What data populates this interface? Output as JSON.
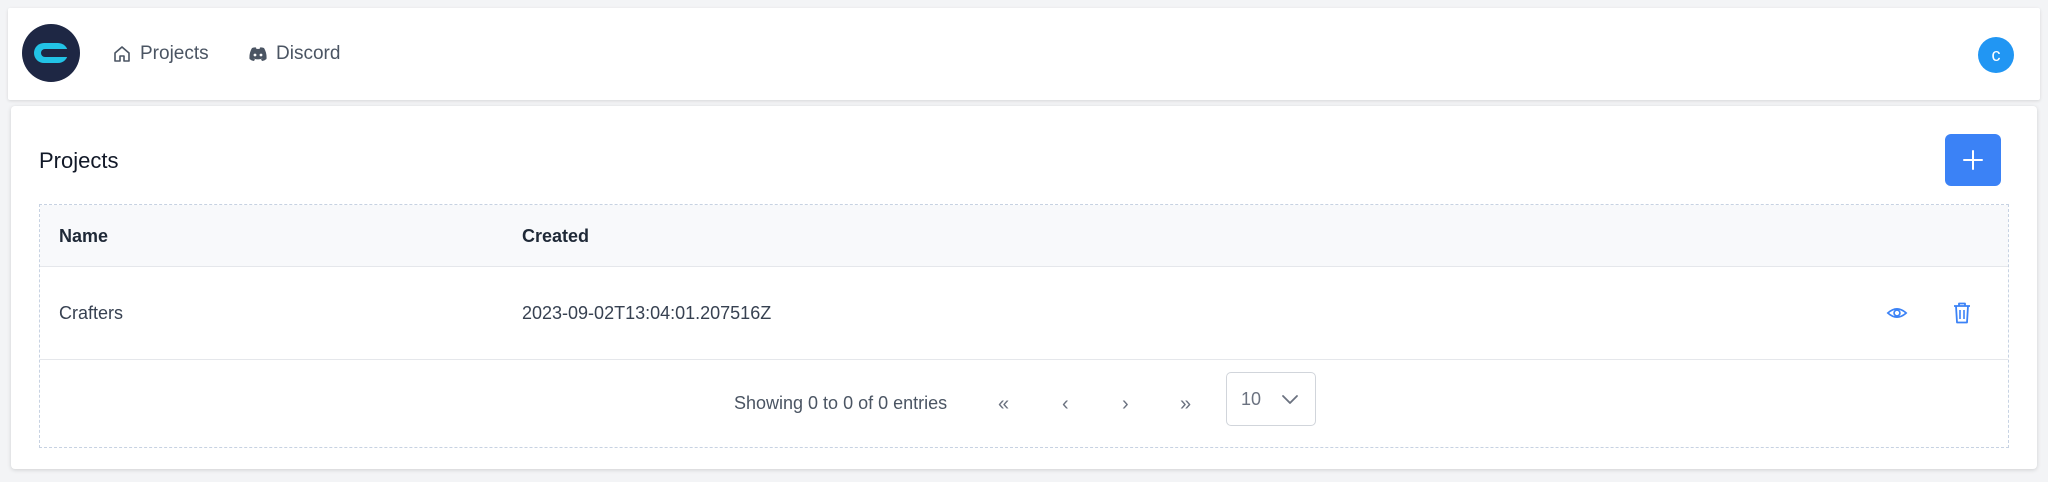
{
  "nav": {
    "projects_label": "Projects",
    "discord_label": "Discord",
    "avatar_initial": "c"
  },
  "page": {
    "title": "Projects",
    "add_icon": "plus-icon"
  },
  "table": {
    "columns": [
      "Name",
      "Created"
    ],
    "rows": [
      {
        "name": "Crafters",
        "created": "2023-09-02T13:04:01.207516Z"
      }
    ]
  },
  "pagination": {
    "info": "Showing 0 to 0 of 0 entries",
    "first": "«",
    "prev": "‹",
    "next": "›",
    "last": "»",
    "page_size": "10"
  },
  "colors": {
    "accent": "#3b82f6",
    "avatar": "#2196f3",
    "logo_bg": "#1e2744",
    "logo_fg": "#22c3e6"
  }
}
